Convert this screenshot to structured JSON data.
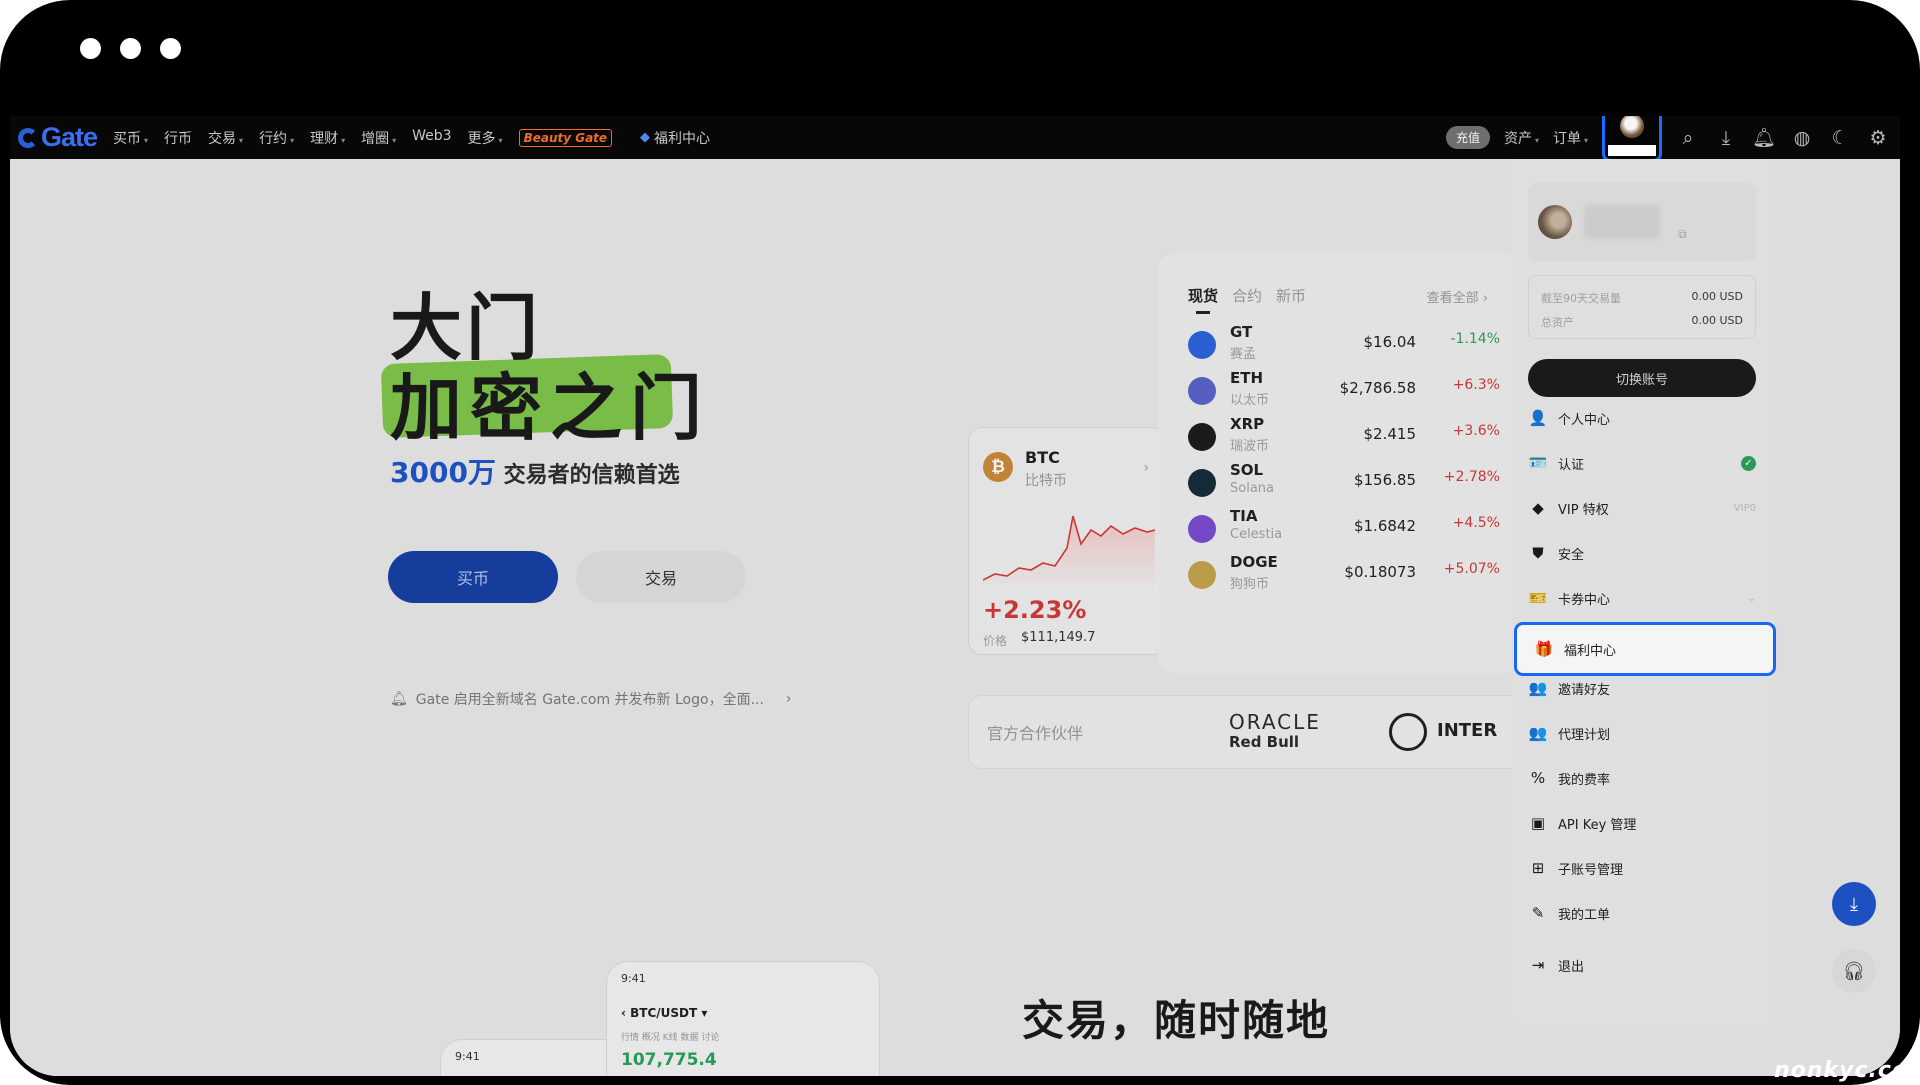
{
  "window": {
    "dots": 3
  },
  "nav": {
    "logo": "Gate",
    "items": [
      {
        "label": "买币",
        "caret": true
      },
      {
        "label": "行币",
        "caret": false
      },
      {
        "label": "交易",
        "caret": true
      },
      {
        "label": "行约",
        "caret": true
      },
      {
        "label": "理财",
        "caret": true
      },
      {
        "label": "增圈",
        "caret": true
      },
      {
        "label": "Web3",
        "caret": false
      },
      {
        "label": "更多",
        "caret": true
      }
    ],
    "promo_badge": "Beauty Gate",
    "welfare": "福利中心",
    "deposit": "充值",
    "assets": "资产",
    "orders": "订单",
    "icons": [
      "search-icon",
      "download-icon",
      "bell-icon",
      "globe-icon",
      "moon-icon",
      "gear-icon"
    ]
  },
  "hero": {
    "title1": "大门",
    "title2": "加密之门",
    "sub_num": "3000万",
    "sub_text": "交易者的信赖首选",
    "buy": "买币",
    "trade": "交易",
    "notice": "Gate 启用全新域名 Gate.com 并发布新 Logo，全面..."
  },
  "btc_card": {
    "symbol": "BTC",
    "name": "比特币",
    "change": "+2.23%",
    "price_label": "价格",
    "price": "$111,149.7"
  },
  "market": {
    "tabs": [
      "现货",
      "合约",
      "新币"
    ],
    "view_all": "查看全部",
    "rows": [
      {
        "sym": "GT",
        "name": "赛孟",
        "price": "$16.04",
        "chg": "-1.14%",
        "dir": "down",
        "color": "#2b63d9"
      },
      {
        "sym": "ETH",
        "name": "以太币",
        "price": "$2,786.58",
        "chg": "+6.3%",
        "dir": "up",
        "color": "#5a63c9"
      },
      {
        "sym": "XRP",
        "name": "瑞波币",
        "price": "$2.415",
        "chg": "+3.6%",
        "dir": "up",
        "color": "#1d1d1d"
      },
      {
        "sym": "SOL",
        "name": "Solana",
        "price": "$156.85",
        "chg": "+2.78%",
        "dir": "up",
        "color": "#162d3a"
      },
      {
        "sym": "TIA",
        "name": "Celestia",
        "price": "$1.6842",
        "chg": "+4.5%",
        "dir": "up",
        "color": "#7a4bd1"
      },
      {
        "sym": "DOGE",
        "name": "狗狗币",
        "price": "$0.18073",
        "chg": "+5.07%",
        "dir": "up",
        "color": "#c2a24a"
      }
    ]
  },
  "partner": {
    "label": "官方合作伙伴",
    "oracle": "ORACLE",
    "redbull": "Red Bull",
    "inter": "INTER"
  },
  "phone": {
    "time": "9:41",
    "pair": "BTC/USDT",
    "tabs": "行情   概况   K线   数据   讨论",
    "price": "107,775.4",
    "time2": "9:41"
  },
  "slogan": "交易，随时随地",
  "dropdown": {
    "stat1_k": "截至90天交易量",
    "stat1_v": "0.00 USD",
    "stat2_k": "总资产",
    "stat2_v": "0.00 USD",
    "switch": "切换账号",
    "items": [
      {
        "label": "个人中心",
        "icon": "person-icon",
        "glyph": "👤"
      },
      {
        "label": "认证",
        "icon": "id-card-icon",
        "glyph": "🪪",
        "verified": true
      },
      {
        "label": "VIP 特权",
        "icon": "diamond-icon",
        "glyph": "◆",
        "right": "VIP0"
      },
      {
        "label": "安全",
        "icon": "shield-icon",
        "glyph": "⛊"
      },
      {
        "label": "卡券中心",
        "icon": "ticket-icon",
        "glyph": "🎫",
        "chevron": true
      },
      {
        "label": "福利中心",
        "icon": "gift-icon",
        "glyph": "🎁",
        "selected": true
      },
      {
        "label": "邀请好友",
        "icon": "invite-icon",
        "glyph": "👥"
      },
      {
        "label": "代理计划",
        "icon": "agent-icon",
        "glyph": "👥"
      },
      {
        "label": "我的费率",
        "icon": "percent-icon",
        "glyph": "%"
      },
      {
        "label": "API Key 管理",
        "icon": "api-icon",
        "glyph": "▣"
      },
      {
        "label": "子账号管理",
        "icon": "subaccount-icon",
        "glyph": "⊞"
      },
      {
        "label": "我的工单",
        "icon": "ticket-edit-icon",
        "glyph": "✎"
      },
      {
        "label": "退出",
        "icon": "logout-icon",
        "glyph": "⇥"
      }
    ]
  },
  "watermark": "nonkyc.cc"
}
